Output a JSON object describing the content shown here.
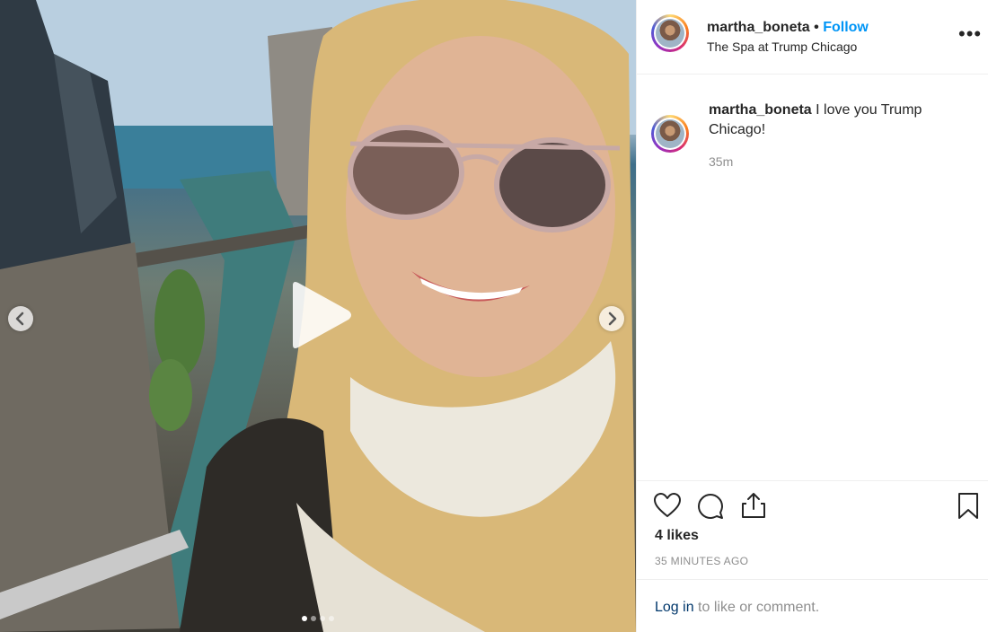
{
  "post": {
    "username": "martha_boneta",
    "separator": " • ",
    "follow_label": "Follow",
    "location": "The Spa at Trump Chicago",
    "more_options_icon": "more-horizontal-icon"
  },
  "caption": {
    "username": "martha_boneta",
    "text": " I love you Trump Chicago!",
    "time": "35m"
  },
  "actions": {
    "like_icon": "heart-icon",
    "comment_icon": "comment-bubble-icon",
    "share_icon": "share-upload-icon",
    "save_icon": "bookmark-icon"
  },
  "stats": {
    "likes": "4 likes",
    "time_ago": "35 MINUTES AGO"
  },
  "footer": {
    "login_link": "Log in",
    "login_rest": " to like or comment."
  },
  "carousel": {
    "slide_count": 4,
    "current_slide": 1
  },
  "colors": {
    "follow_blue": "#0095f6",
    "link_dark_blue": "#00376b",
    "muted_gray": "#8e8e8e"
  }
}
